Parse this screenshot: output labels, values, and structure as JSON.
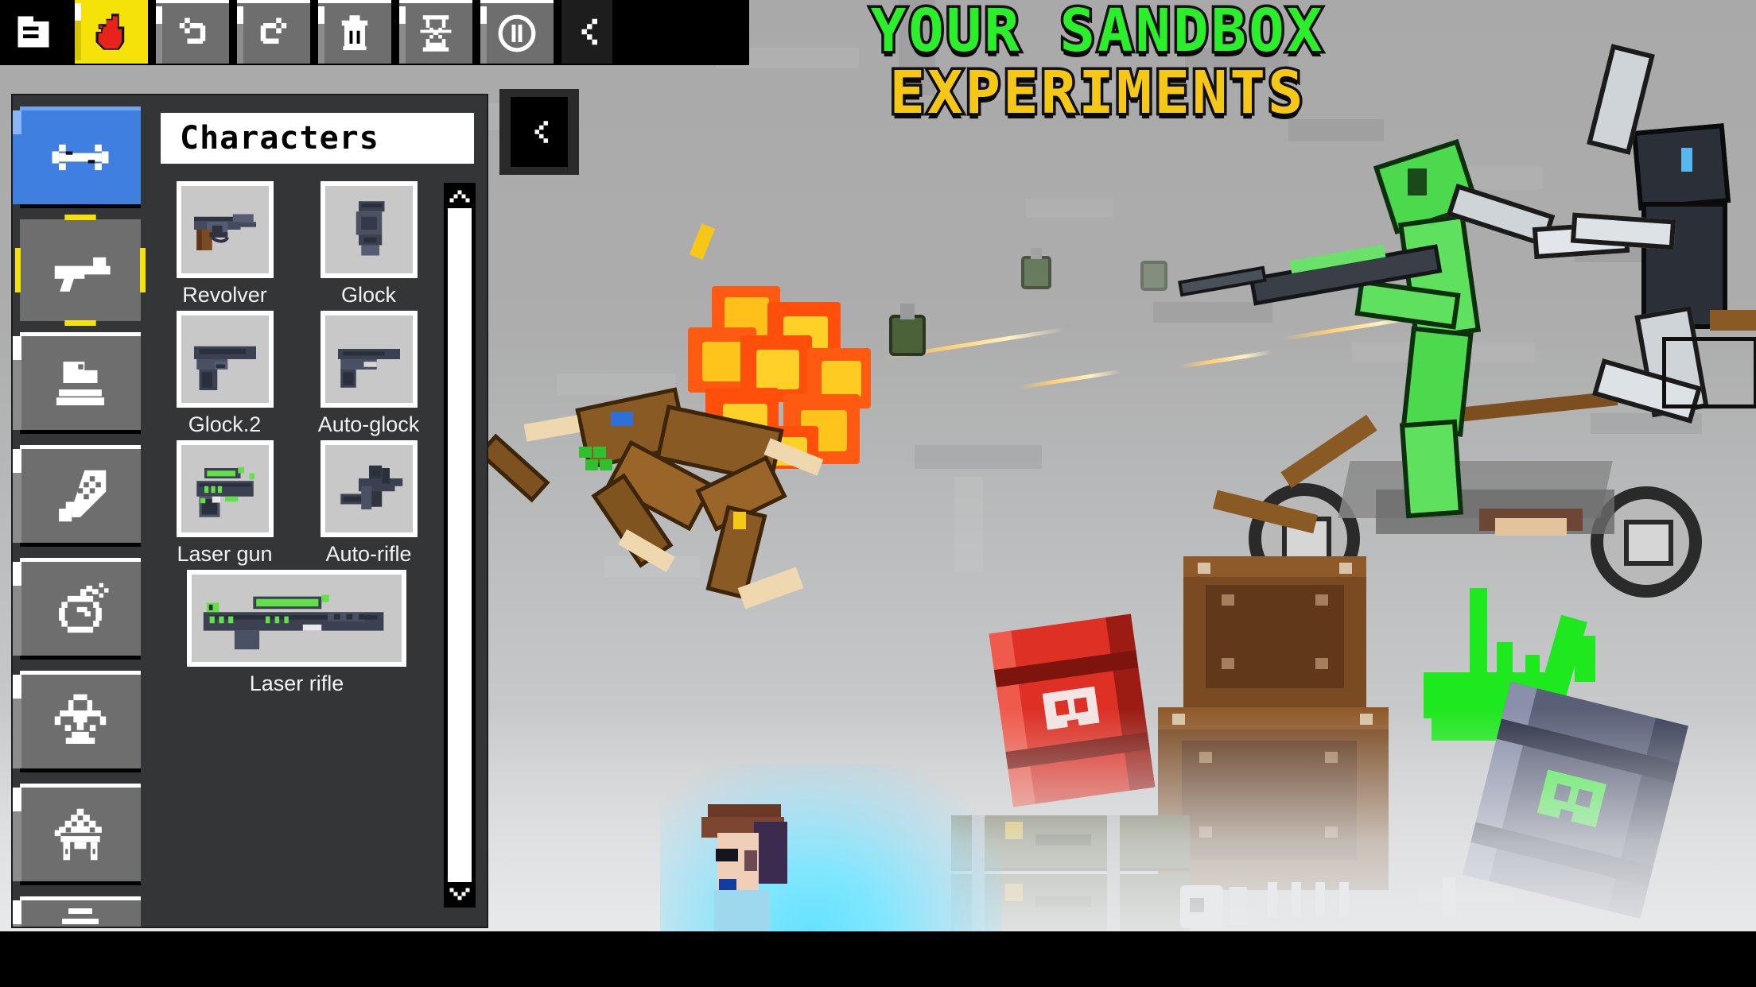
{
  "app": {
    "title_line1": "YOUR SANDBOX",
    "title_line2": "EXPERIMENTS",
    "title_color_line1": "#2bef2b",
    "title_color_line2": "#f5c818"
  },
  "toolbar": {
    "buttons": [
      {
        "name": "file-menu",
        "icon": "file-icon",
        "label": "File",
        "state": "normal"
      },
      {
        "name": "hand-tool",
        "icon": "hand-icon",
        "label": "Hand",
        "state": "selected"
      },
      {
        "name": "undo",
        "icon": "undo-icon",
        "label": "Undo",
        "state": "normal"
      },
      {
        "name": "redo",
        "icon": "redo-icon",
        "label": "Redo",
        "state": "normal"
      },
      {
        "name": "delete-all",
        "icon": "trash-icon",
        "label": "Delete",
        "state": "normal"
      },
      {
        "name": "slow-motion",
        "icon": "hourglass-icon",
        "label": "Slow",
        "state": "normal"
      },
      {
        "name": "pause",
        "icon": "pause-icon",
        "label": "Pause",
        "state": "normal"
      },
      {
        "name": "collapse-toolbar",
        "icon": "chevron-left-icon",
        "label": "Collapse",
        "state": "dark"
      }
    ]
  },
  "panel": {
    "title": "Characters",
    "collapse_button_icon": "chevron-left-icon",
    "categories": [
      {
        "name": "sidebar-item-connections",
        "icon": "double-arrow-icon",
        "state": "selected-blue"
      },
      {
        "name": "sidebar-item-guns",
        "icon": "gun-icon",
        "state": "selected-yellow"
      },
      {
        "name": "sidebar-item-objects",
        "icon": "object-icon",
        "state": "normal"
      },
      {
        "name": "sidebar-item-melee",
        "icon": "sword-icon",
        "state": "normal"
      },
      {
        "name": "sidebar-item-explosives",
        "icon": "bomb-icon",
        "state": "normal"
      },
      {
        "name": "sidebar-item-hazards",
        "icon": "biohazard-icon",
        "state": "normal"
      },
      {
        "name": "sidebar-item-buildings",
        "icon": "house-icon",
        "state": "normal"
      },
      {
        "name": "sidebar-item-more",
        "icon": "partial-icon",
        "state": "normal"
      }
    ],
    "items": [
      {
        "label": "Revolver",
        "icon": "revolver-icon",
        "wide": false
      },
      {
        "label": "Glock",
        "icon": "glock-icon",
        "wide": false
      },
      {
        "label": "Glock.2",
        "icon": "glock2-icon",
        "wide": false
      },
      {
        "label": "Auto-glock",
        "icon": "autoglock-icon",
        "wide": false
      },
      {
        "label": "Laser gun",
        "icon": "lasergun-icon",
        "wide": false
      },
      {
        "label": "Auto-rifle",
        "icon": "autorifle-icon",
        "wide": false
      },
      {
        "label": "Laser rifle",
        "icon": "laserrifle-icon",
        "wide": true
      }
    ],
    "scrollbar": {
      "name": "items-scrollbar",
      "up_icon": "chevron-up-icon",
      "down_icon": "chevron-down-icon"
    }
  },
  "scene": {
    "objects": [
      {
        "name": "ragdoll-brown",
        "type": "character"
      },
      {
        "name": "explosion-effect",
        "type": "effect"
      },
      {
        "name": "bullet-tracer",
        "type": "effect"
      },
      {
        "name": "grenade",
        "type": "item"
      },
      {
        "name": "green-character-rider",
        "type": "character"
      },
      {
        "name": "dark-character-rider",
        "type": "character"
      },
      {
        "name": "motorcycle",
        "type": "vehicle"
      },
      {
        "name": "explosive-barrel-red",
        "type": "item"
      },
      {
        "name": "acid-barrel-green",
        "type": "item"
      },
      {
        "name": "wooden-crate-upper",
        "type": "item"
      },
      {
        "name": "wooden-crate-lower",
        "type": "item"
      },
      {
        "name": "ammo-crate",
        "type": "item"
      },
      {
        "name": "skeleton-remains",
        "type": "item"
      },
      {
        "name": "human-character-water",
        "type": "character"
      },
      {
        "name": "acid-splash",
        "type": "effect"
      }
    ]
  }
}
